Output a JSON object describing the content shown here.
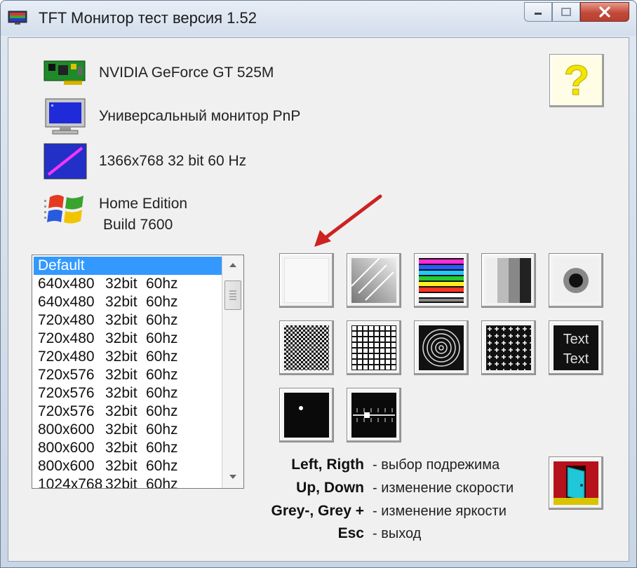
{
  "window": {
    "title": "TFT Монитор тест версия 1.52",
    "icons": [
      "app-monitor-icon",
      "minimize-icon",
      "maximize-icon",
      "close-icon"
    ]
  },
  "info": {
    "gpu": "NVIDIA GeForce GT 525M",
    "monitor": "Универсальный монитор PnP",
    "mode": "1366x768 32 bit 60 Hz",
    "os_line1": "Home Edition",
    "os_line2": "Build 7600"
  },
  "modes_list": {
    "selected": "Default",
    "items": [
      {
        "res": "640x480",
        "bits": "32bit",
        "hz": "60hz"
      },
      {
        "res": "640x480",
        "bits": "32bit",
        "hz": "60hz"
      },
      {
        "res": "720x480",
        "bits": "32bit",
        "hz": "60hz"
      },
      {
        "res": "720x480",
        "bits": "32bit",
        "hz": "60hz"
      },
      {
        "res": "720x480",
        "bits": "32bit",
        "hz": "60hz"
      },
      {
        "res": "720x576",
        "bits": "32bit",
        "hz": "60hz"
      },
      {
        "res": "720x576",
        "bits": "32bit",
        "hz": "60hz"
      },
      {
        "res": "720x576",
        "bits": "32bit",
        "hz": "60hz"
      },
      {
        "res": "800x600",
        "bits": "32bit",
        "hz": "60hz"
      },
      {
        "res": "800x600",
        "bits": "32bit",
        "hz": "60hz"
      },
      {
        "res": "800x600",
        "bits": "32bit",
        "hz": "60hz"
      },
      {
        "res": "1024x768",
        "bits": "32bit",
        "hz": "60hz"
      }
    ]
  },
  "test_buttons": {
    "text_sample_1": "Text",
    "text_sample_2": "Text"
  },
  "legend": [
    {
      "key": "Left, Rigth",
      "desc": "- выбор подрежима"
    },
    {
      "key": "Up, Down",
      "desc": "- изменение скорости"
    },
    {
      "key": "Grey-, Grey +",
      "desc": "- изменение яркости"
    },
    {
      "key": "Esc",
      "desc": "- выход"
    }
  ],
  "colors": {
    "selection": "#3399ff",
    "annotation_arrow": "#cc2222",
    "help_mark": "#f2e600"
  }
}
